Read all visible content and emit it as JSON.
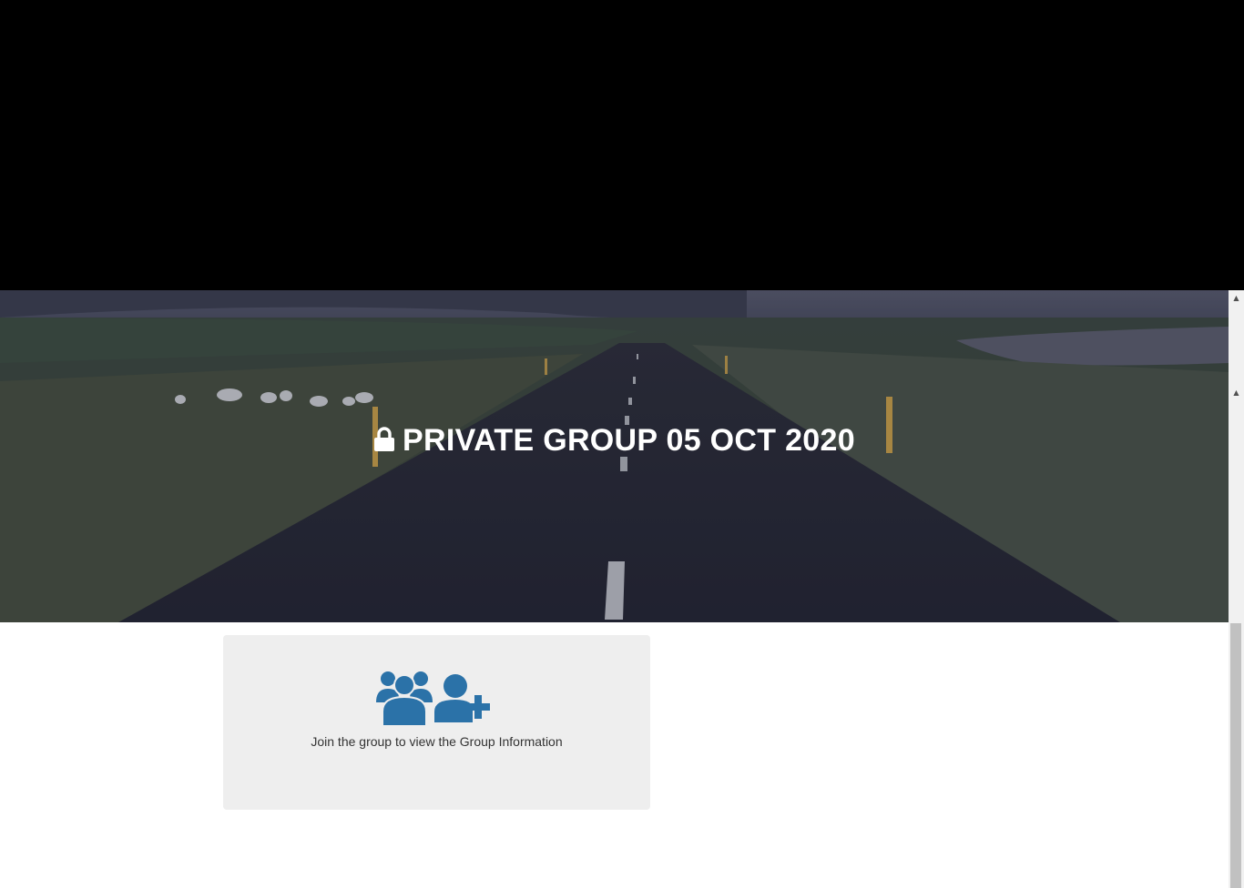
{
  "hero": {
    "title": "PRIVATE GROUP 05 OCT 2020",
    "lock_icon": "lock-icon"
  },
  "card": {
    "message": "Join the group to view the Group Information",
    "icons": [
      "users-group-icon",
      "user-add-icon"
    ],
    "icon_color": "#2b72a8",
    "background": "#eeeeee"
  },
  "colors": {
    "top_band": "#000000",
    "hero_overlay": "#2a2d3f"
  }
}
